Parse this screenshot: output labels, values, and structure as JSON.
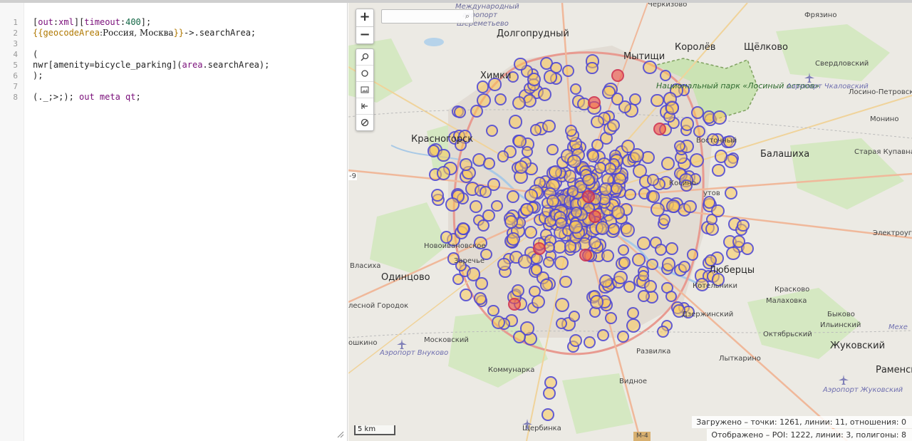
{
  "editor": {
    "line_numbers": [
      "1",
      "2",
      "3",
      "4",
      "5",
      "6",
      "7",
      "8"
    ],
    "lines": {
      "l1": {
        "a": "[",
        "b": "out",
        "c": ":",
        "d": "xml",
        "e": "][",
        "f": "timeout",
        "g": ":",
        "h": "400",
        "i": "];"
      },
      "l2": {
        "a": "{{",
        "b": "geocodeArea",
        "c": ":Россия, Москва",
        "d": "}}",
        "e": "->.searchArea;"
      },
      "l4": "(",
      "l5": {
        "a": "nwr[amenity=bicycle_parking](",
        "b": "area",
        "c": ".searchArea);"
      },
      "l6": ");",
      "l8": {
        "a": "(._;>;); ",
        "b": "out meta qt",
        "c": ";"
      }
    }
  },
  "map": {
    "zoom_in": "+",
    "zoom_out": "−",
    "scale_label": "5 km",
    "stats_loaded": "Загружено – точки: 1261, линии: 11, отношения: 0",
    "stats_shown": "Отображено – POI: 1222, линии: 3, полигоны: 8",
    "places": {
      "chernoe": "Черкизово",
      "frazino": "Фрязино",
      "mezhdunarodny": "Международный",
      "aeroport": "аэропорт",
      "sheremetyevo": "Шереметьево",
      "dolgoprudny": "Долгопрудный",
      "mytishchi": "Мытищи",
      "korolev": "Королёв",
      "shchelkovo": "Щёлково",
      "sverdlovsky": "Свердловский",
      "khimki": "Химки",
      "park": "Национальный парк «Лосиный остров»",
      "airport_chkalov": "Аэропорт Чкаловский",
      "losino": "Лосино-Петровск",
      "krasnogorsk": "Красногорск",
      "vostochny": "Восточный",
      "balashikha": "Балашиха",
      "monino": "Монино",
      "staraya": "Старая Купавна",
      "ruta": "-9",
      "kosino": "Косино-",
      "utov": "утов",
      "electrougli": "Электроуг",
      "novoivanovskoe": "Новоивановское",
      "zarechye": "Заречье",
      "vlasikha": "Власиха",
      "odintsovo": "Одинцово",
      "lyubertsy": "Люберцы",
      "kotelniki": "Котельники",
      "kraskovo": "Красково",
      "malakhovka": "Малаховка",
      "lesnoy": "лесной Городок",
      "dzerzhinsky": "Дзержинский",
      "bykovo": "Быково",
      "ilyinsky": "Ильинский",
      "ramensk": "Раменск",
      "oktyabrsky": "Октябрьский",
      "moskovsky": "Московский",
      "meshcher": "Мехе",
      "aeroport_vnukovo": "Аэропорт Внуково",
      "shkino": "ошкино",
      "razvilka": "Развилка",
      "lytkarino": "Лыткарино",
      "zhukovsky": "Жуковский",
      "kommunarka": "Коммунарка",
      "aeroport_zhukovsky": "Аэропорт Жуковский",
      "vidnoe": "Видное",
      "shcherbinka": "Щербинка",
      "m4": "М-4"
    }
  },
  "colors": {
    "marker_stroke": "#3232e6",
    "marker_fill": "#fac85a",
    "marker_dense": "#f05046"
  }
}
